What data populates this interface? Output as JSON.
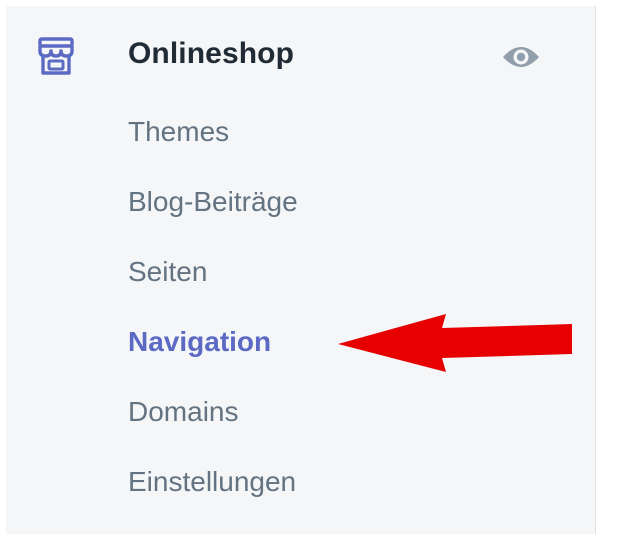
{
  "sidebar": {
    "section": {
      "icon": "store-icon",
      "title": "Onlineshop",
      "view_icon": "eye-icon"
    },
    "items": [
      {
        "label": "Themes",
        "active": false
      },
      {
        "label": "Blog-Beiträge",
        "active": false
      },
      {
        "label": "Seiten",
        "active": false
      },
      {
        "label": "Navigation",
        "active": true
      },
      {
        "label": "Domains",
        "active": false
      },
      {
        "label": "Einstellungen",
        "active": false
      }
    ]
  },
  "annotation": {
    "icon": "arrow-left-icon",
    "color": "#e60000"
  },
  "colors": {
    "sidebar_bg": "#f4f6f8",
    "accent": "#5c6ac4",
    "text": "#637381",
    "title": "#212b36"
  }
}
